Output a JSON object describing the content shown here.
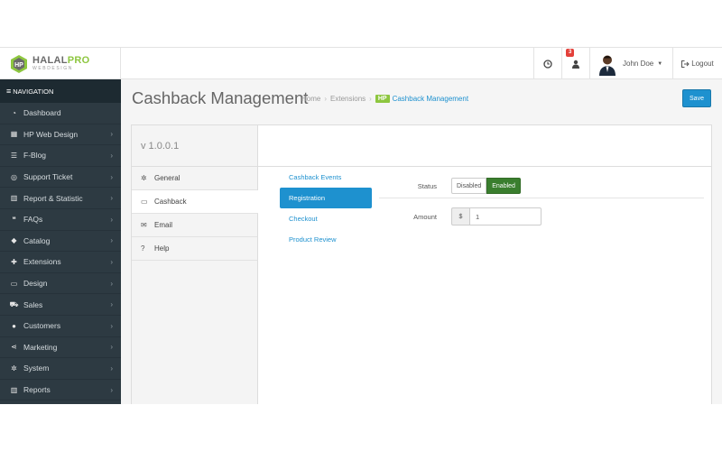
{
  "brand": {
    "name_part1": "HALAL",
    "name_part2": "PRO",
    "tagline": "WEBDESIGN"
  },
  "header": {
    "notification_count": "3",
    "user_name": "John Doe",
    "logout_label": "Logout"
  },
  "sidebar": {
    "heading": "NAVIGATION",
    "items": [
      {
        "label": "Dashboard",
        "icon": "dashboard-icon",
        "has_children": false
      },
      {
        "label": "HP Web Design",
        "icon": "windows-icon",
        "has_children": true
      },
      {
        "label": "F-Blog",
        "icon": "list-icon",
        "has_children": true
      },
      {
        "label": "Support Ticket",
        "icon": "lifebuoy-icon",
        "has_children": true
      },
      {
        "label": "Report & Statistic",
        "icon": "bar-chart-icon",
        "has_children": true
      },
      {
        "label": "FAQs",
        "icon": "comments-icon",
        "has_children": true
      },
      {
        "label": "Catalog",
        "icon": "tag-icon",
        "has_children": true
      },
      {
        "label": "Extensions",
        "icon": "puzzle-icon",
        "has_children": true
      },
      {
        "label": "Design",
        "icon": "monitor-icon",
        "has_children": true
      },
      {
        "label": "Sales",
        "icon": "cart-icon",
        "has_children": true
      },
      {
        "label": "Customers",
        "icon": "user-icon",
        "has_children": true
      },
      {
        "label": "Marketing",
        "icon": "share-icon",
        "has_children": true
      },
      {
        "label": "System",
        "icon": "cog-icon",
        "has_children": true
      },
      {
        "label": "Reports",
        "icon": "bar-chart-icon",
        "has_children": true
      }
    ]
  },
  "page": {
    "title": "Cashback Management",
    "breadcrumb": {
      "home": "Home",
      "extensions": "Extensions",
      "tag": "HP",
      "current": "Cashback Management"
    },
    "save_label": "Save",
    "version": "v 1.0.0.1"
  },
  "left_tabs": [
    {
      "label": "General",
      "icon": "cog-icon",
      "active": false
    },
    {
      "label": "Cashback",
      "icon": "credit-card-icon",
      "active": true
    },
    {
      "label": "Email",
      "icon": "envelope-icon",
      "active": false
    },
    {
      "label": "Help",
      "icon": "question-icon",
      "active": false
    }
  ],
  "sub_tabs": [
    {
      "label": "Cashback Events",
      "active": false
    },
    {
      "label": "Registration",
      "active": true
    },
    {
      "label": "Checkout",
      "active": false
    },
    {
      "label": "Product Review",
      "active": false
    }
  ],
  "form": {
    "status_label": "Status",
    "status_options": [
      "Disabled",
      "Enabled"
    ],
    "status_selected": "Enabled",
    "amount_label": "Amount",
    "amount_prefix": "$",
    "amount_value": "1"
  },
  "colors": {
    "accent": "#1e91cf",
    "brand_green": "#8dc63f",
    "enabled_green": "#3a7e2e",
    "sidebar_bg": "#2d3a42",
    "badge_red": "#e3403a"
  }
}
